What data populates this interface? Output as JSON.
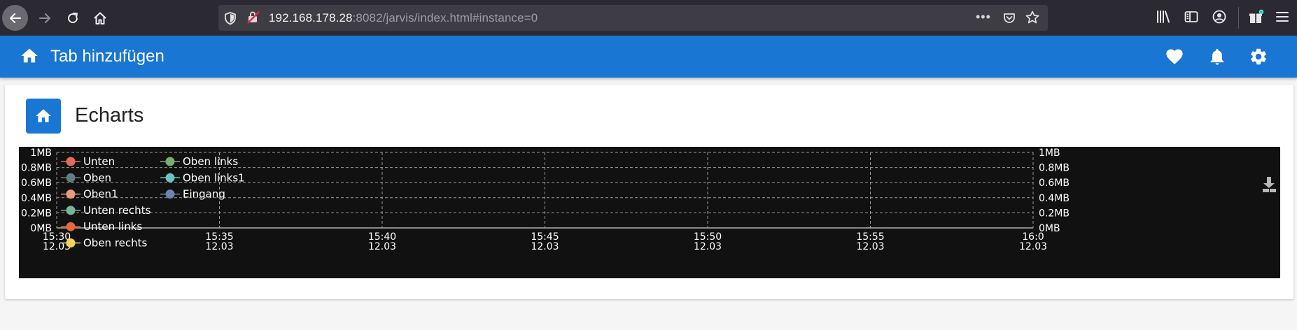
{
  "browser": {
    "url_host": "192.168.178.28",
    "url_rest": ":8082/jarvis/index.html#instance=0",
    "more_dots": "•••"
  },
  "app": {
    "title": "Tab hinzufügen",
    "header_color": "#1976d2"
  },
  "card": {
    "title": "Echarts"
  },
  "chart_data": {
    "type": "line",
    "y_axis_left": {
      "ticks": [
        "1MB",
        "0.8MB",
        "0.6MB",
        "0.4MB",
        "0.2MB",
        "0MB"
      ],
      "ylim": [
        0,
        1
      ]
    },
    "y_axis_right": {
      "ticks": [
        "1MB",
        "0.8MB",
        "0.6MB",
        "0.4MB",
        "0.2MB",
        "0MB"
      ],
      "ylim": [
        0,
        1
      ]
    },
    "x_axis": {
      "ticks": [
        {
          "time": "15:30",
          "date": "12.03"
        },
        {
          "time": "15:35",
          "date": "12.03"
        },
        {
          "time": "15:40",
          "date": "12.03"
        },
        {
          "time": "15:45",
          "date": "12.03"
        },
        {
          "time": "15:50",
          "date": "12.03"
        },
        {
          "time": "15:55",
          "date": "12.03"
        },
        {
          "time": "16:0",
          "date": "12.03"
        }
      ]
    },
    "grid": true,
    "legend_position": "top-left",
    "series": [
      {
        "name": "Unten",
        "color": "#e26b5a",
        "values": []
      },
      {
        "name": "Oben",
        "color": "#5f7f86",
        "values": []
      },
      {
        "name": "Oben1",
        "color": "#e89a7a",
        "values": []
      },
      {
        "name": "Unten rechts",
        "color": "#74b796",
        "values": []
      },
      {
        "name": "Unten links",
        "color": "#e8683c",
        "values": []
      },
      {
        "name": "Oben rechts",
        "color": "#f1d35c",
        "values": []
      },
      {
        "name": "Oben links",
        "color": "#78ae75",
        "values": []
      },
      {
        "name": "Oben links1",
        "color": "#6ec3c0",
        "values": []
      },
      {
        "name": "Eingang",
        "color": "#6b85b0",
        "values": []
      }
    ]
  }
}
